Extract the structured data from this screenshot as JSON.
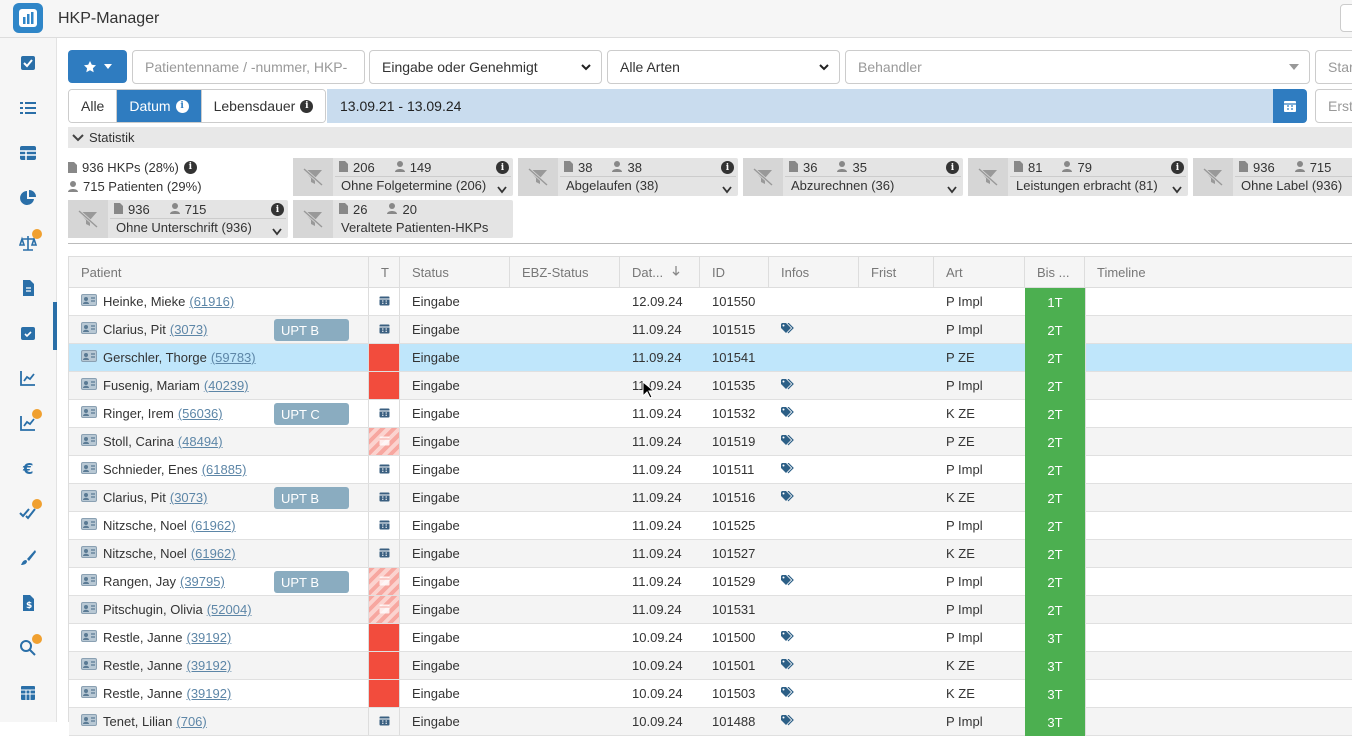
{
  "app": {
    "title": "HKP-Manager"
  },
  "filters": {
    "patient_search_placeholder": "Patientenname / -nummer, HKP-",
    "status_select": "Eingabe oder Genehmigt",
    "art_select": "Alle Arten",
    "behandler_placeholder": "Behandler",
    "start_placeholder": "Star",
    "ersteller_placeholder": "Erste",
    "date_tabs": [
      "Alle",
      "Datum",
      "Lebensdauer"
    ],
    "date_range": "13.09.21 - 13.09.24"
  },
  "statistik": {
    "label": "Statistik",
    "hkps_summary": "936 HKPs (28%)",
    "patients_summary": "715 Patienten (29%)",
    "cards": [
      {
        "hkps": "206",
        "patients": "149",
        "label": "Ohne Folgetermine (206)"
      },
      {
        "hkps": "38",
        "patients": "38",
        "label": "Abgelaufen (38)"
      },
      {
        "hkps": "36",
        "patients": "35",
        "label": "Abzurechnen (36)"
      },
      {
        "hkps": "81",
        "patients": "79",
        "label": "Leistungen erbracht (81)"
      },
      {
        "hkps": "936",
        "patients": "715",
        "label": "Ohne Label (936)"
      },
      {
        "hkps": "936",
        "patients": "715",
        "label": "Ohne Unterschrift (936)"
      },
      {
        "hkps": "26",
        "patients": "20",
        "label": "Veraltete Patienten-HKPs"
      }
    ]
  },
  "table": {
    "columns": [
      "Patient",
      "T",
      "Status",
      "EBZ-Status",
      "Dat...",
      "ID",
      "Infos",
      "Frist",
      "Art",
      "Bis ...",
      "Timeline"
    ],
    "rows": [
      {
        "name": "Heinke, Mieke",
        "num": "(61916)",
        "badge": "",
        "t": "cal",
        "status": "Eingabe",
        "date": "12.09.24",
        "id": "101550",
        "info": false,
        "art": "P Impl",
        "bis": "1T"
      },
      {
        "name": "Clarius, Pit",
        "num": "(3073)",
        "badge": "UPT B",
        "t": "cal",
        "status": "Eingabe",
        "date": "11.09.24",
        "id": "101515",
        "info": true,
        "art": "P Impl",
        "bis": "2T"
      },
      {
        "name": "Gerschler, Thorge",
        "num": "(59783)",
        "badge": "",
        "t": "red",
        "status": "Eingabe",
        "date": "11.09.24",
        "id": "101541",
        "info": false,
        "art": "P ZE",
        "bis": "2T"
      },
      {
        "name": "Fusenig, Mariam",
        "num": "(40239)",
        "badge": "",
        "t": "red",
        "status": "Eingabe",
        "date": "11.09.24",
        "id": "101535",
        "info": true,
        "art": "P Impl",
        "bis": "2T"
      },
      {
        "name": "Ringer, Irem",
        "num": "(56036)",
        "badge": "UPT C",
        "t": "cal",
        "status": "Eingabe",
        "date": "11.09.24",
        "id": "101532",
        "info": true,
        "art": "K ZE",
        "bis": "2T"
      },
      {
        "name": "Stoll, Carina",
        "num": "(48494)",
        "badge": "",
        "t": "hatch",
        "status": "Eingabe",
        "date": "11.09.24",
        "id": "101519",
        "info": true,
        "art": "P ZE",
        "bis": "2T"
      },
      {
        "name": "Schnieder, Enes",
        "num": "(61885)",
        "badge": "",
        "t": "cal",
        "status": "Eingabe",
        "date": "11.09.24",
        "id": "101511",
        "info": true,
        "art": "P Impl",
        "bis": "2T"
      },
      {
        "name": "Clarius, Pit",
        "num": "(3073)",
        "badge": "UPT B",
        "t": "cal",
        "status": "Eingabe",
        "date": "11.09.24",
        "id": "101516",
        "info": true,
        "art": "K ZE",
        "bis": "2T"
      },
      {
        "name": "Nitzsche, Noel",
        "num": "(61962)",
        "badge": "",
        "t": "cal",
        "status": "Eingabe",
        "date": "11.09.24",
        "id": "101525",
        "info": false,
        "art": "P Impl",
        "bis": "2T"
      },
      {
        "name": "Nitzsche, Noel",
        "num": "(61962)",
        "badge": "",
        "t": "cal",
        "status": "Eingabe",
        "date": "11.09.24",
        "id": "101527",
        "info": false,
        "art": "K ZE",
        "bis": "2T"
      },
      {
        "name": "Rangen, Jay",
        "num": "(39795)",
        "badge": "UPT B",
        "t": "hatch",
        "status": "Eingabe",
        "date": "11.09.24",
        "id": "101529",
        "info": true,
        "art": "P Impl",
        "bis": "2T"
      },
      {
        "name": "Pitschugin, Olivia",
        "num": "(52004)",
        "badge": "",
        "t": "hatch",
        "status": "Eingabe",
        "date": "11.09.24",
        "id": "101531",
        "info": false,
        "art": "P Impl",
        "bis": "2T"
      },
      {
        "name": "Restle, Janne",
        "num": "(39192)",
        "badge": "",
        "t": "red",
        "status": "Eingabe",
        "date": "10.09.24",
        "id": "101500",
        "info": true,
        "art": "P Impl",
        "bis": "3T"
      },
      {
        "name": "Restle, Janne",
        "num": "(39192)",
        "badge": "",
        "t": "red",
        "status": "Eingabe",
        "date": "10.09.24",
        "id": "101501",
        "info": true,
        "art": "K ZE",
        "bis": "3T"
      },
      {
        "name": "Restle, Janne",
        "num": "(39192)",
        "badge": "",
        "t": "red",
        "status": "Eingabe",
        "date": "10.09.24",
        "id": "101503",
        "info": true,
        "art": "K ZE",
        "bis": "3T"
      },
      {
        "name": "Tenet, Lilian",
        "num": "(706)",
        "badge": "",
        "t": "cal",
        "status": "Eingabe",
        "date": "10.09.24",
        "id": "101488",
        "info": true,
        "art": "P Impl",
        "bis": "3T"
      }
    ]
  },
  "colors": {
    "primary": "#2f7cc0",
    "bis_green": "#4caf50",
    "t_red": "#f24c3d",
    "selected_row": "#bfe6fb",
    "date_bg": "#c9dcee"
  }
}
